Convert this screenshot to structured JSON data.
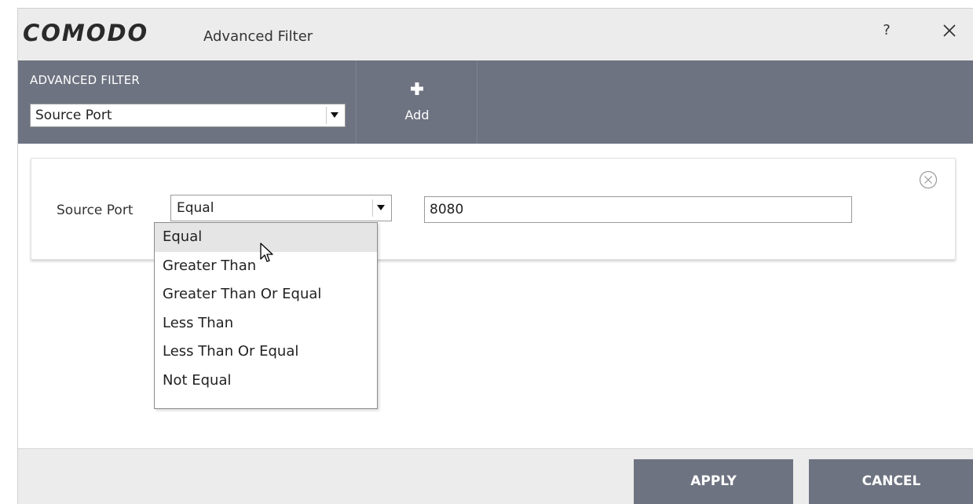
{
  "window": {
    "logo_text": "COMODO",
    "title": "Advanced Filter",
    "help_label": "?",
    "close_icon": "close-icon"
  },
  "toolbar": {
    "heading": "ADVANCED FILTER",
    "filter_type_value": "Source Port",
    "add_label": "Add",
    "add_icon": "plus-icon"
  },
  "condition": {
    "label": "Source Port",
    "operator_value": "Equal",
    "value": "8080",
    "remove_icon": "circle-x-icon"
  },
  "operator_options": [
    {
      "label": "Equal",
      "selected": true
    },
    {
      "label": "Greater Than",
      "selected": false
    },
    {
      "label": "Greater Than Or Equal",
      "selected": false
    },
    {
      "label": "Less Than",
      "selected": false
    },
    {
      "label": "Less Than Or Equal",
      "selected": false
    },
    {
      "label": "Not Equal",
      "selected": false
    }
  ],
  "footer": {
    "apply_label": "APPLY",
    "cancel_label": "CANCEL"
  },
  "colors": {
    "toolbar_bg": "#6e7381",
    "button_bg": "#6e7381",
    "window_bg": "#ececec"
  }
}
